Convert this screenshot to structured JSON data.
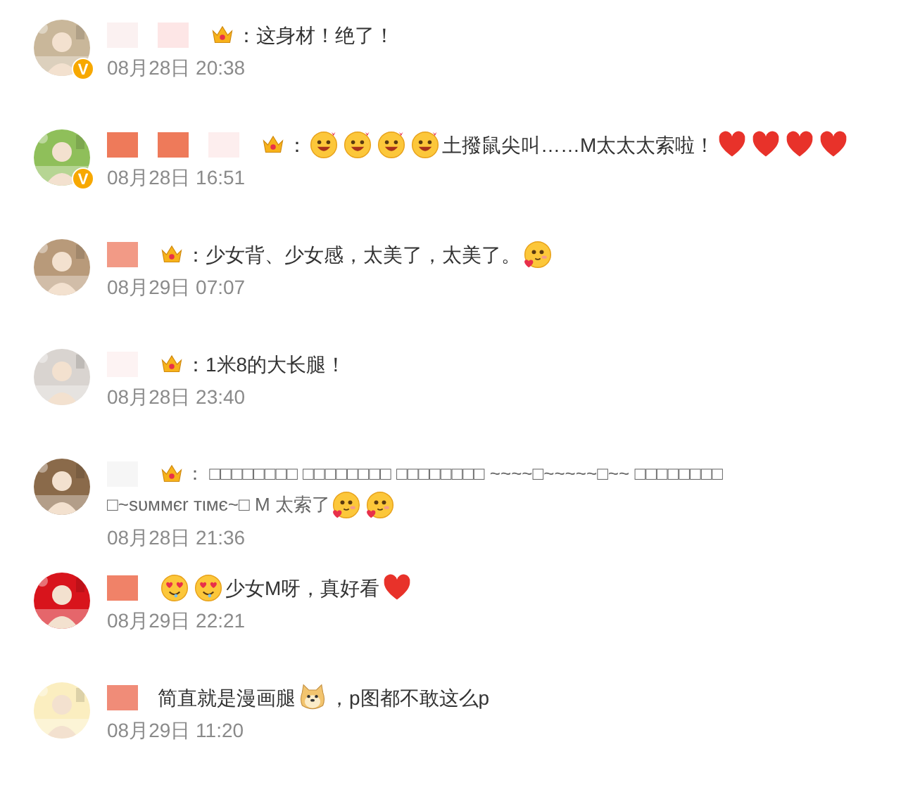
{
  "comments": [
    {
      "verified": true,
      "badge": "V",
      "name_blocks": [
        {
          "color": "#fbf1f1"
        },
        {
          "color": "#fde6e6"
        }
      ],
      "member_crown": true,
      "lines": [
        [
          {
            "kind": "text",
            "text": "：这身材！绝了！"
          }
        ]
      ],
      "time": "08月28日 20:38"
    },
    {
      "verified": true,
      "badge": "V",
      "name_blocks": [
        {
          "color": "#ee7a5a"
        },
        {
          "color": "#ee7a5a"
        },
        {
          "color": "#fdeeee"
        }
      ],
      "member_crown": true,
      "lines": [
        [
          {
            "kind": "text",
            "text": "："
          },
          {
            "kind": "grin"
          },
          {
            "kind": "grin"
          },
          {
            "kind": "grin"
          },
          {
            "kind": "grin"
          },
          {
            "kind": "text",
            "text": "土撥鼠尖叫……M太太太索啦！"
          },
          {
            "kind": "heart"
          },
          {
            "kind": "heart"
          },
          {
            "kind": "heart"
          },
          {
            "kind": "heart"
          }
        ]
      ],
      "time": "08月28日 16:51"
    },
    {
      "verified": false,
      "name_blocks": [
        {
          "color": "#f29a86"
        }
      ],
      "member_crown": true,
      "lines": [
        [
          {
            "kind": "text",
            "text": "：少女背、少女感，太美了，太美了。"
          },
          {
            "kind": "blush"
          }
        ]
      ],
      "time": "08月29日 07:07"
    },
    {
      "verified": false,
      "name_blocks": [
        {
          "color": "#fdf3f3"
        }
      ],
      "member_crown": true,
      "lines": [
        [
          {
            "kind": "text",
            "text": "：1米8的大长腿！"
          }
        ]
      ],
      "time": "08月28日 23:40"
    },
    {
      "verified": false,
      "name_blocks": [
        {
          "color": "#f6f6f6"
        }
      ],
      "member_crown": true,
      "lines": [
        [
          {
            "kind": "text",
            "text": "： □□□□□□□□ □□□□□□□□ □□□□□□□□ ~~~~□~~~~~□~~ □□□□□□□□"
          }
        ],
        [
          {
            "kind": "text",
            "text": "□~ѕυммєr тιмє~□ M 太索了"
          },
          {
            "kind": "blush"
          },
          {
            "kind": "blush"
          }
        ]
      ],
      "time": "08月28日 21:36"
    },
    {
      "verified": false,
      "name_blocks": [
        {
          "color": "#f08268"
        }
      ],
      "member_crown": false,
      "lines": [
        [
          {
            "kind": "hearteyes"
          },
          {
            "kind": "hearteyes"
          },
          {
            "kind": "text",
            "text": "少女M呀，真好看"
          },
          {
            "kind": "heart"
          }
        ]
      ],
      "time": "08月29日 22:21"
    },
    {
      "verified": false,
      "name_blocks": [
        {
          "color": "#f08c78"
        }
      ],
      "member_crown": false,
      "lines": [
        [
          {
            "kind": "text",
            "text": "简直就是漫画腿"
          },
          {
            "kind": "doge"
          },
          {
            "kind": "text",
            "text": "，p图都不敢这么p"
          }
        ]
      ],
      "time": "08月29日 11:20"
    }
  ]
}
